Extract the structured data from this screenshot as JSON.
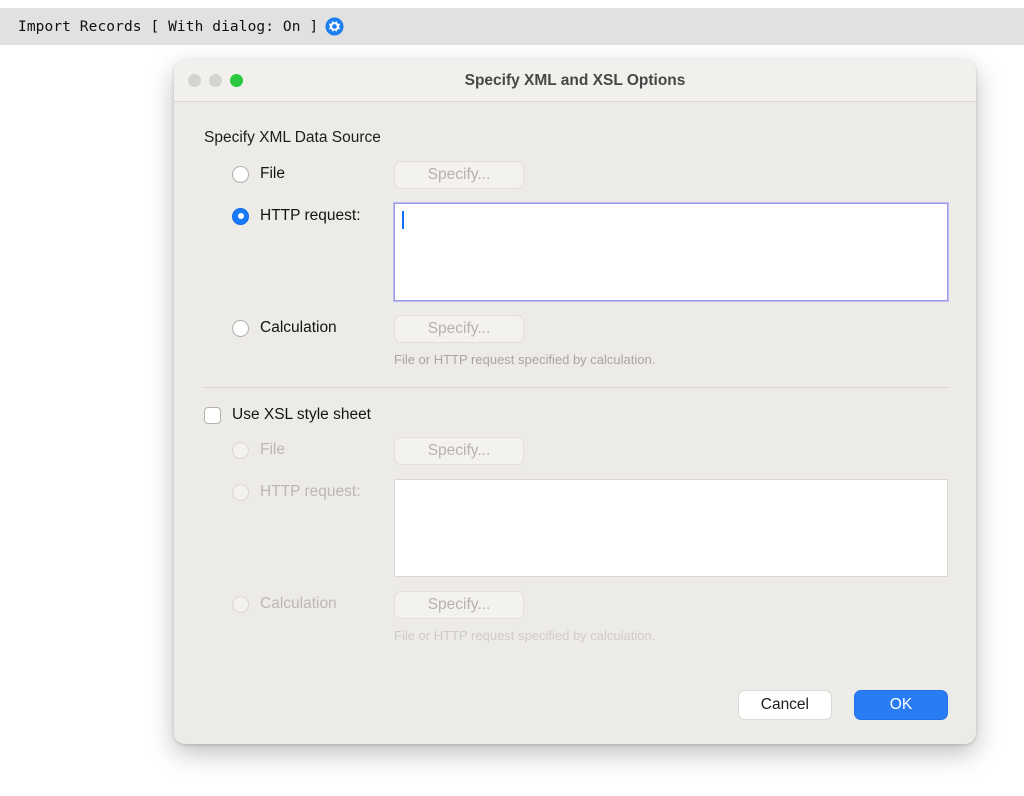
{
  "topbar": {
    "script_step": "Import Records [ With dialog: On ]",
    "gear_icon": "gear-icon",
    "background_color": "#e1e1e1"
  },
  "dialog": {
    "title": "Specify XML and XSL Options",
    "window_controls": {
      "close": "close-button",
      "minimize": "minimize-button",
      "zoom": "zoom-button",
      "close_color": "#d5d3d0",
      "minimize_color": "#d5d3d0",
      "zoom_color": "#28c93f"
    },
    "xml_section": {
      "title": "Specify XML Data Source",
      "file": {
        "label": "File",
        "selected": false,
        "specify_label": "Specify...",
        "specify_enabled": false
      },
      "http": {
        "label": "HTTP request:",
        "selected": true,
        "value": "",
        "focused": true
      },
      "calculation": {
        "label": "Calculation",
        "selected": false,
        "specify_label": "Specify...",
        "specify_enabled": false,
        "hint": "File or HTTP request specified by calculation."
      }
    },
    "xsl_section": {
      "checkbox_label": "Use XSL style sheet",
      "checked": false,
      "file": {
        "label": "File",
        "selected": false,
        "specify_label": "Specify...",
        "specify_enabled": false
      },
      "http": {
        "label": "HTTP request:",
        "selected": false,
        "value": ""
      },
      "calculation": {
        "label": "Calculation",
        "selected": false,
        "specify_label": "Specify...",
        "specify_enabled": false,
        "hint": "File or HTTP request specified by calculation."
      }
    },
    "footer": {
      "cancel_label": "Cancel",
      "ok_label": "OK",
      "ok_color": "#2a7cf5"
    }
  }
}
